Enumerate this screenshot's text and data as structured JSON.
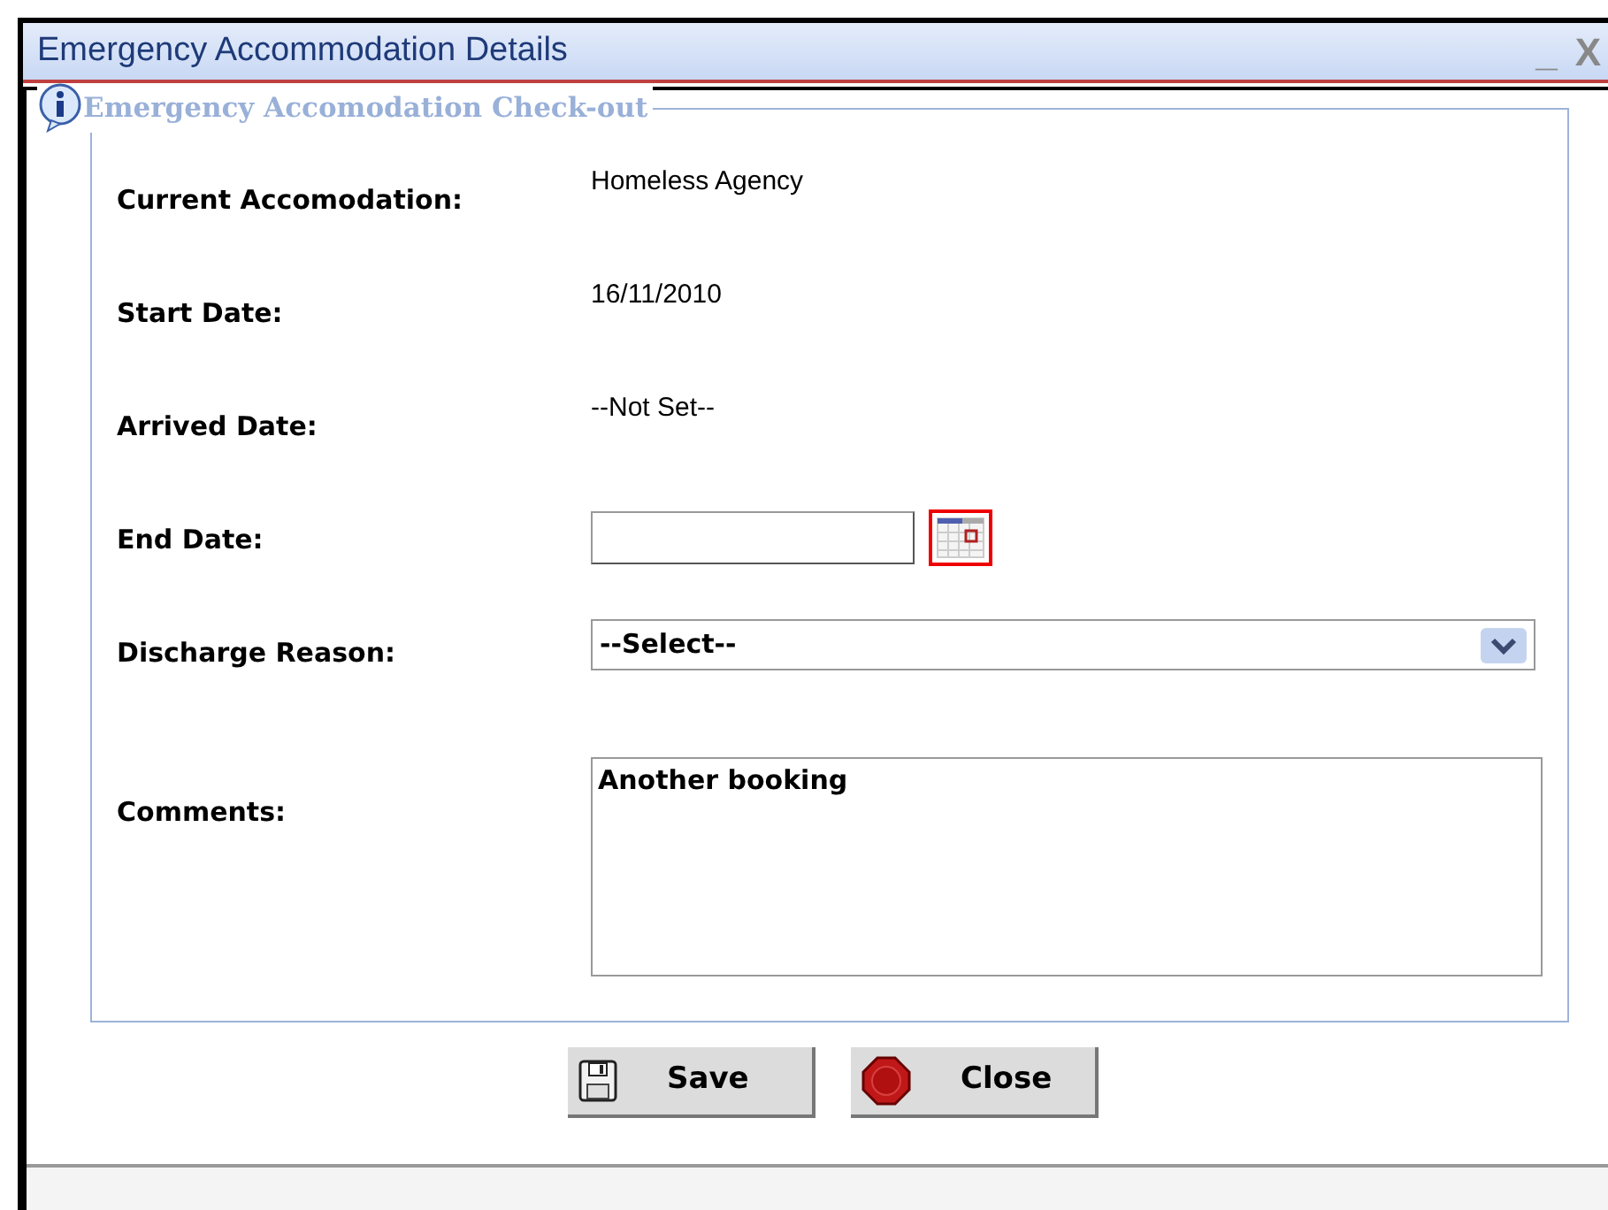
{
  "window": {
    "title": "Emergency Accommodation Details",
    "minimize": "_",
    "close": "X"
  },
  "group": {
    "title": "Emergency Accomodation Check-out"
  },
  "fields": [
    {
      "kind": "text",
      "label": "Current Accomodation:",
      "value": "Homeless Agency"
    },
    {
      "kind": "text",
      "label": "Start Date:",
      "value": "16/11/2010"
    },
    {
      "kind": "text",
      "label": "Arrived Date:",
      "value": "--Not Set--"
    },
    {
      "kind": "date",
      "label": "End Date:"
    },
    {
      "kind": "select",
      "label": "Discharge Reason:",
      "value": "--Select--"
    },
    {
      "kind": "textarea",
      "label": "Comments:",
      "value": "Another booking"
    }
  ],
  "buttons": [
    {
      "kind": "save",
      "label": "Save"
    },
    {
      "kind": "close",
      "label": "Close"
    }
  ]
}
